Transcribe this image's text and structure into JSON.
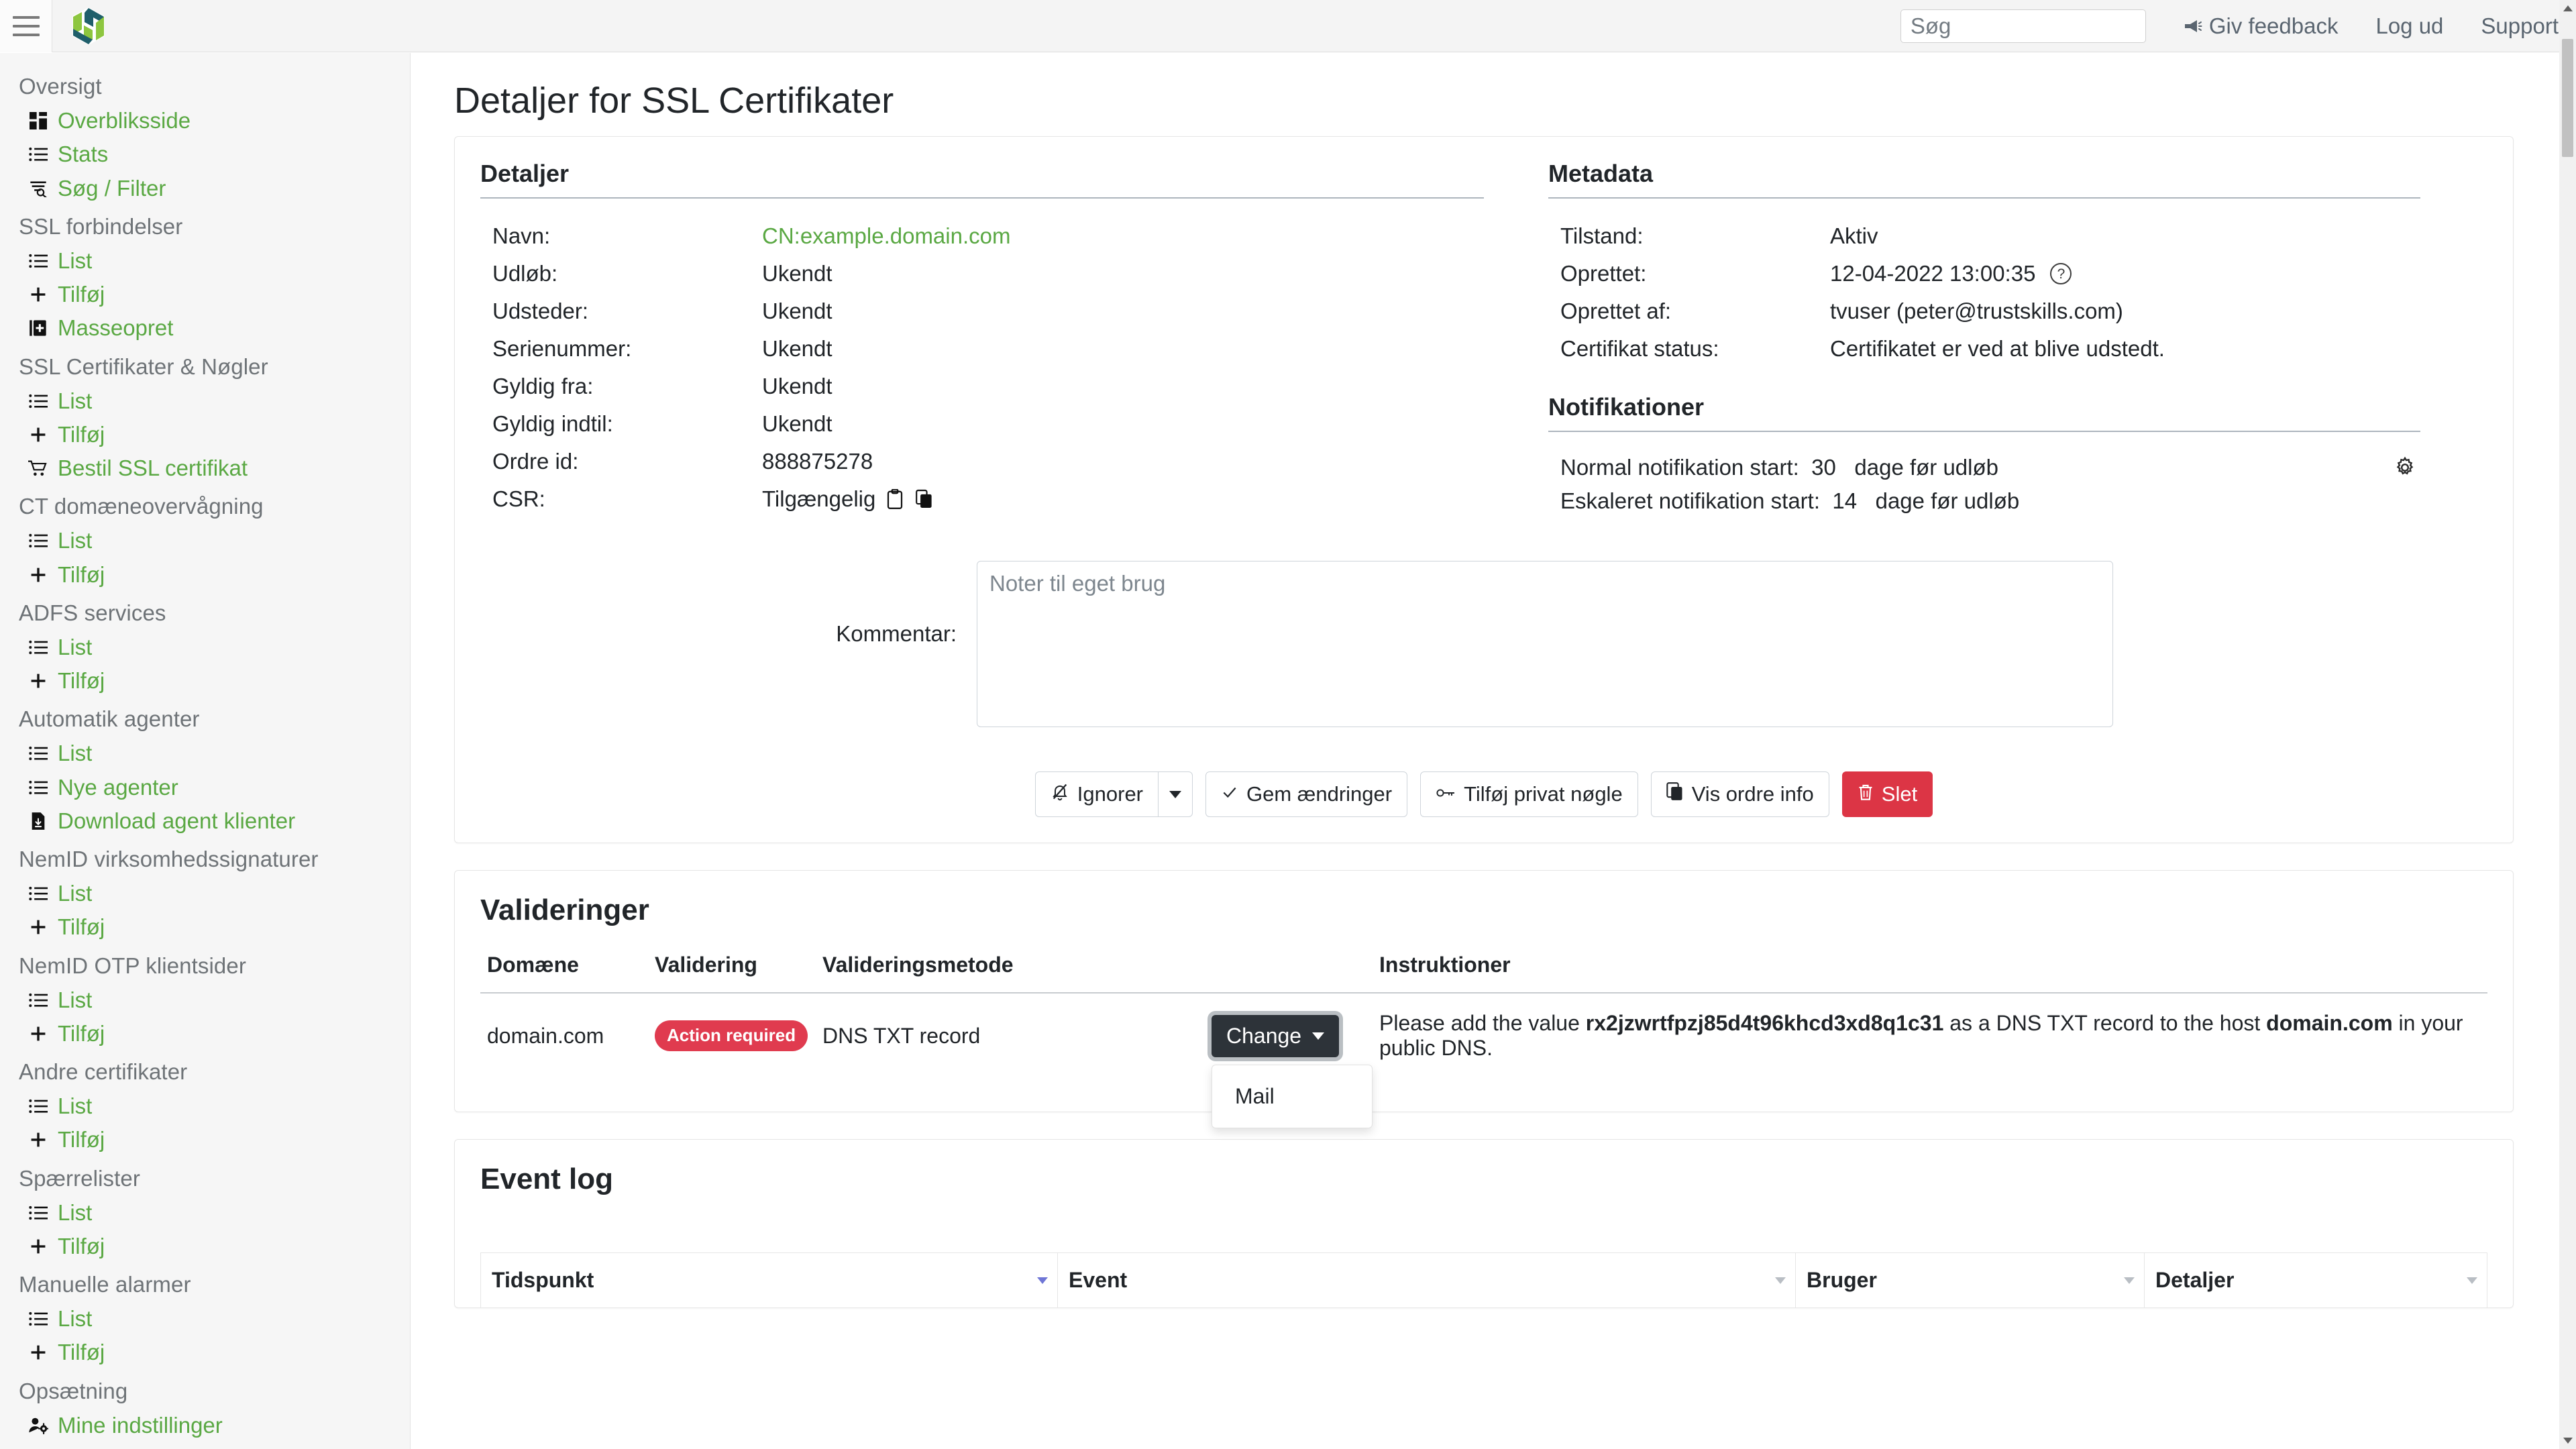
{
  "topbar": {
    "menu_icon": "hamburger-icon",
    "logo_icon": "app-logo-icon",
    "search_placeholder": "Søg",
    "search_value": "",
    "feedback_label": "Giv feedback",
    "feedback_icon": "megaphone-icon",
    "logout_label": "Log ud",
    "support_label": "Support"
  },
  "sidebar": {
    "groups": [
      {
        "title": "Oversigt",
        "items": [
          {
            "label": "Overbliksside",
            "icon": "dashboard-icon"
          },
          {
            "label": "Stats",
            "icon": "list-icon"
          },
          {
            "label": "Søg / Filter",
            "icon": "filter-search-icon"
          }
        ]
      },
      {
        "title": "SSL forbindelser",
        "items": [
          {
            "label": "List",
            "icon": "list-icon"
          },
          {
            "label": "Tilføj",
            "icon": "plus-icon"
          },
          {
            "label": "Masseopret",
            "icon": "bulk-create-icon"
          }
        ]
      },
      {
        "title": "SSL Certifikater & Nøgler",
        "items": [
          {
            "label": "List",
            "icon": "list-icon"
          },
          {
            "label": "Tilføj",
            "icon": "plus-icon"
          },
          {
            "label": "Bestil SSL certifikat",
            "icon": "cart-icon"
          }
        ]
      },
      {
        "title": "CT domæneovervågning",
        "items": [
          {
            "label": "List",
            "icon": "list-icon"
          },
          {
            "label": "Tilføj",
            "icon": "plus-icon"
          }
        ]
      },
      {
        "title": "ADFS services",
        "items": [
          {
            "label": "List",
            "icon": "list-icon"
          },
          {
            "label": "Tilføj",
            "icon": "plus-icon"
          }
        ]
      },
      {
        "title": "Automatik agenter",
        "items": [
          {
            "label": "List",
            "icon": "list-icon"
          },
          {
            "label": "Nye agenter",
            "icon": "list-icon"
          },
          {
            "label": "Download agent klienter",
            "icon": "file-download-icon"
          }
        ]
      },
      {
        "title": "NemID virksomhedssignaturer",
        "items": [
          {
            "label": "List",
            "icon": "list-icon"
          },
          {
            "label": "Tilføj",
            "icon": "plus-icon"
          }
        ]
      },
      {
        "title": "NemID OTP klientsider",
        "items": [
          {
            "label": "List",
            "icon": "list-icon"
          },
          {
            "label": "Tilføj",
            "icon": "plus-icon"
          }
        ]
      },
      {
        "title": "Andre certifikater",
        "items": [
          {
            "label": "List",
            "icon": "list-icon"
          },
          {
            "label": "Tilføj",
            "icon": "plus-icon"
          }
        ]
      },
      {
        "title": "Spærrelister",
        "items": [
          {
            "label": "List",
            "icon": "list-icon"
          },
          {
            "label": "Tilføj",
            "icon": "plus-icon"
          }
        ]
      },
      {
        "title": "Manuelle alarmer",
        "items": [
          {
            "label": "List",
            "icon": "list-icon"
          },
          {
            "label": "Tilføj",
            "icon": "plus-icon"
          }
        ]
      },
      {
        "title": "Opsætning",
        "items": [
          {
            "label": "Mine indstillinger",
            "icon": "user-settings-icon"
          }
        ]
      }
    ]
  },
  "page": {
    "title": "Detaljer for SSL Certifikater"
  },
  "details": {
    "section_title": "Detaljer",
    "rows": [
      {
        "label": "Navn:",
        "value": "CN:example.domain.com",
        "link": true
      },
      {
        "label": "Udløb:",
        "value": "Ukendt"
      },
      {
        "label": "Udsteder:",
        "value": "Ukendt"
      },
      {
        "label": "Serienummer:",
        "value": "Ukendt"
      },
      {
        "label": "Gyldig fra:",
        "value": "Ukendt"
      },
      {
        "label": "Gyldig indtil:",
        "value": "Ukendt"
      },
      {
        "label": "Ordre id:",
        "value": "888875278"
      },
      {
        "label": "CSR:",
        "value": "Tilgængelig",
        "icons": [
          "clipboard-icon",
          "copy-icon"
        ]
      }
    ]
  },
  "metadata": {
    "section_title": "Metadata",
    "rows": [
      {
        "label": "Tilstand:",
        "value": "Aktiv"
      },
      {
        "label": "Oprettet:",
        "value": "12-04-2022 13:00:35",
        "help": "?"
      },
      {
        "label": "Oprettet af:",
        "value": "tvuser (peter@trustskills.com)"
      },
      {
        "label": "Certifikat status:",
        "value": "Certifikatet er ved at blive udstedt."
      }
    ]
  },
  "notifications": {
    "section_title": "Notifikationer",
    "normal_label": "Normal notifikation start:",
    "normal_days": "30",
    "normal_suffix": "dage før udløb",
    "escalated_label": "Eskaleret notifikation start:",
    "escalated_days": "14",
    "escalated_suffix": "dage før udløb",
    "settings_icon": "gear-icon"
  },
  "comment": {
    "label": "Kommentar:",
    "placeholder": "Noter til eget brug",
    "value": ""
  },
  "actions": {
    "ignore_label": "Ignorer",
    "ignore_icon": "bell-slash-icon",
    "ignore_caret_icon": "caret-down-icon",
    "save_label": "Gem ændringer",
    "save_icon": "check-icon",
    "add_key_label": "Tilføj privat nøgle",
    "add_key_icon": "key-icon",
    "order_info_label": "Vis ordre info",
    "order_info_icon": "copy-icon",
    "delete_label": "Slet",
    "delete_icon": "trash-icon",
    "delete_color": "#dc3545"
  },
  "validations": {
    "section_title": "Valideringer",
    "columns": [
      "Domæne",
      "Validering",
      "Valideringsmetode",
      "",
      "Instruktioner"
    ],
    "rows": [
      {
        "domain": "domain.com",
        "status": "Action required",
        "status_color": "#e03b4f",
        "method": "DNS TXT record",
        "change_label": "Change",
        "change_caret_icon": "caret-down-icon",
        "dropdown_items": [
          "Mail"
        ],
        "instruction_prefix": "Please add the value ",
        "instruction_token": "rx2jzwrtfpzj85d4t96khcd3xd8q1c31",
        "instruction_middle": " as a DNS TXT record to the host ",
        "instruction_host": "domain.com",
        "instruction_suffix": " in your public DNS."
      }
    ]
  },
  "event_log": {
    "section_title": "Event log",
    "columns": [
      "Tidspunkt",
      "Event",
      "Bruger",
      "Detaljer"
    ],
    "sorted_column": "Tidspunkt"
  },
  "colors": {
    "link_green": "#5aa843",
    "logo_green": "#8dc63f",
    "logo_teal": "#1f5f6b",
    "danger_red": "#dc3545",
    "dark": "#2d3339"
  }
}
